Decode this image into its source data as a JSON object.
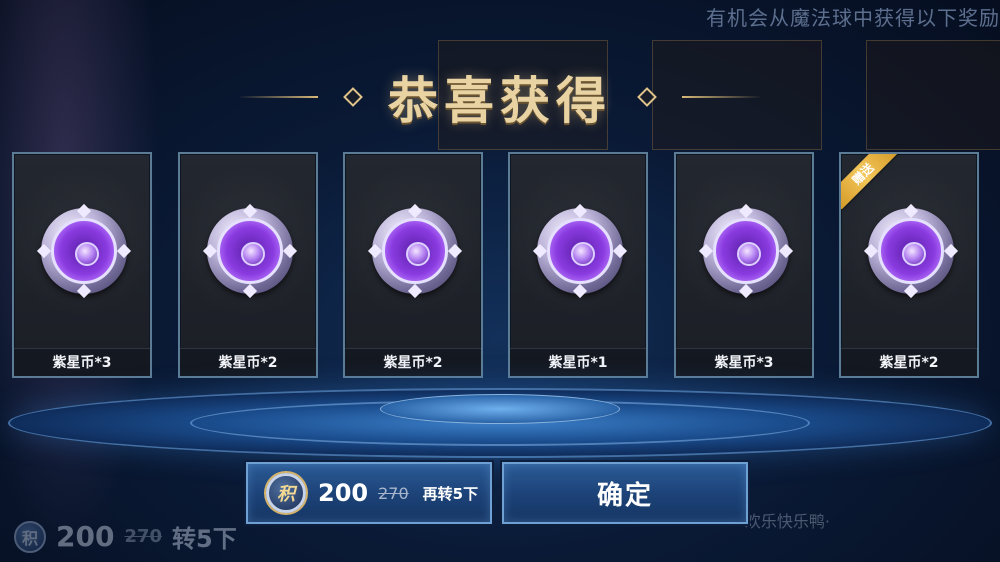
{
  "background": {
    "hint_text": "有机会从魔法球中获得以下奖励",
    "faded_price": "200",
    "faded_old_price": "270",
    "faded_spin_label": "转5下",
    "faded_footer_text": "欢乐快乐鸭·"
  },
  "title": "恭喜获得",
  "rewards": [
    {
      "label": "紫星币*3",
      "gift": false
    },
    {
      "label": "紫星币*2",
      "gift": false
    },
    {
      "label": "紫星币*2",
      "gift": false
    },
    {
      "label": "紫星币*1",
      "gift": false
    },
    {
      "label": "紫星币*3",
      "gift": false
    },
    {
      "label": "紫星币*2",
      "gift": true,
      "gift_label": "赠送"
    }
  ],
  "spin_button": {
    "token_icon": "积",
    "price": "200",
    "old_price": "270",
    "label": "再转5下"
  },
  "confirm_button": {
    "label": "确定"
  },
  "colors": {
    "title_gold": "#e9d3a3",
    "card_border": "#5c7c96",
    "button_blue": "#1c4277",
    "coin_purple": "#8a3be0",
    "ribbon_gold": "#f3c75a"
  }
}
